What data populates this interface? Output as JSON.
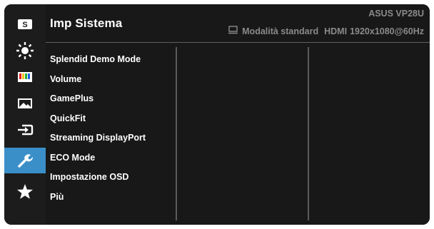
{
  "header": {
    "title": "Imp Sistema",
    "model": "ASUS  VP28U",
    "mode": "Modalità standard",
    "input": "HDMI",
    "resolution": "1920x1080@60Hz"
  },
  "sidebar": {
    "items": [
      {
        "icon": "splendid-icon",
        "label": "S"
      },
      {
        "icon": "brightness-icon"
      },
      {
        "icon": "color-bars-icon"
      },
      {
        "icon": "image-icon"
      },
      {
        "icon": "input-select-icon"
      },
      {
        "icon": "wrench-icon",
        "active": true
      },
      {
        "icon": "star-icon"
      }
    ]
  },
  "menu": {
    "items": [
      "Splendid Demo Mode",
      "Volume",
      "GamePlus",
      "QuickFit",
      "Streaming DisplayPort",
      "ECO Mode",
      "Impostazione OSD",
      "Più"
    ]
  },
  "colors": {
    "background": "#1c1c1c",
    "accent": "#3a8fc9",
    "text": "#ffffff",
    "muted": "#8a8a8a"
  }
}
